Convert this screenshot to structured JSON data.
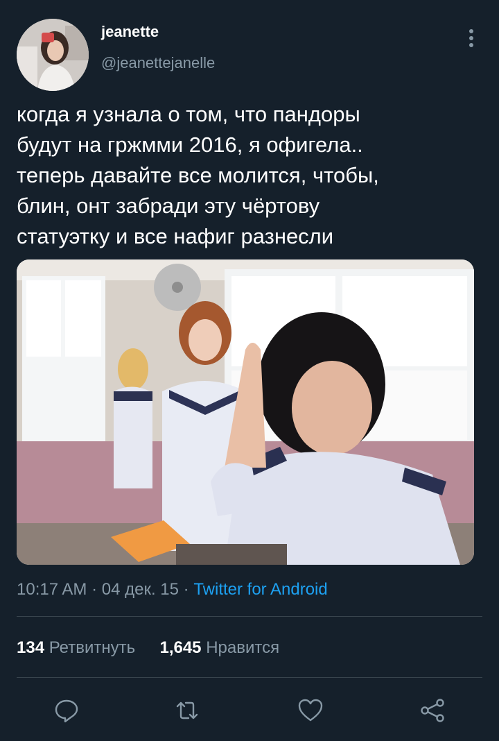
{
  "user": {
    "name": "jeanette",
    "handle": "@jeanettejanelle"
  },
  "tweet": {
    "text": "когда я узнала о том, что пандоры\nбудут на гржмми 2016, я офигела..\nтеперь давайте все молится, чтобы,\nблин, онт забради эту чёртову\nстатуэтку и все нафиг разнесли"
  },
  "meta": {
    "time": "10:17 AM",
    "sep1": " · ",
    "date": "04 дек. 15",
    "sep2": " · ",
    "source": "Twitter for Android"
  },
  "stats": {
    "retweets_count": "134",
    "retweets_label": "Ретвитнуть",
    "likes_count": "1,645",
    "likes_label": "Нравится"
  },
  "actions": [
    "reply-icon",
    "retweet-icon",
    "like-icon",
    "share-icon"
  ],
  "colors": {
    "background": "#15202b",
    "secondary_text": "#8899a6",
    "link": "#1da1f2",
    "divider": "#38444d"
  }
}
